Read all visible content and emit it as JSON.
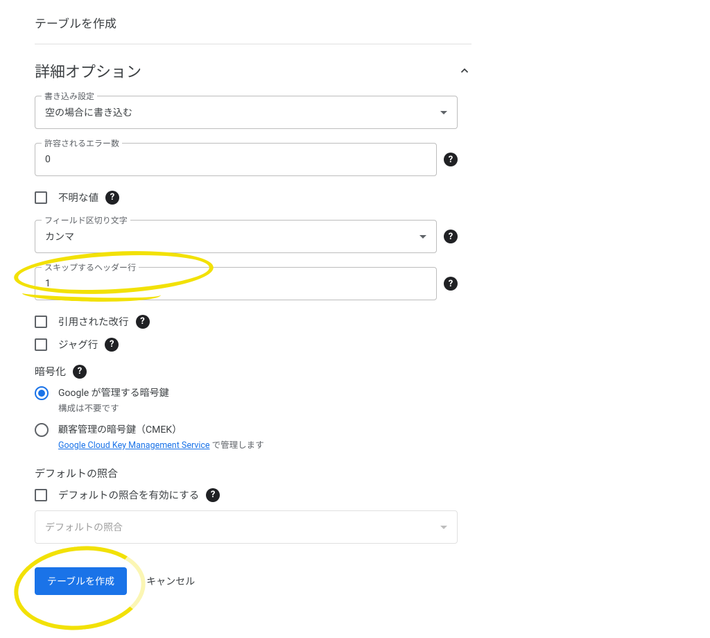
{
  "dialog": {
    "title": "テーブルを作成"
  },
  "advanced": {
    "title": "詳細オプション",
    "expanded": true,
    "write_setting": {
      "label": "書き込み設定",
      "value": "空の場合に書き込む"
    },
    "allowed_errors": {
      "label": "許容されるエラー数",
      "value": "0"
    },
    "unknown_values": {
      "label": "不明な値"
    },
    "field_delimiter": {
      "label": "フィールド区切り文字",
      "value": "カンマ"
    },
    "header_rows": {
      "label": "スキップするヘッダー行",
      "value": "1"
    },
    "quoted_newlines": {
      "label": "引用された改行"
    },
    "jagged_rows": {
      "label": "ジャグ行"
    },
    "encryption": {
      "title": "暗号化",
      "google": {
        "label": "Google が管理する暗号鍵",
        "desc": "構成は不要です"
      },
      "cmek": {
        "label": "顧客管理の暗号鍵（CMEK）",
        "link_text": "Google Cloud Key Management Service",
        "suffix": " で管理します"
      }
    },
    "collation": {
      "title": "デフォルトの照合",
      "enable_label": "デフォルトの照合を有効にする",
      "placeholder": "デフォルトの照合"
    }
  },
  "footer": {
    "create": "テーブルを作成",
    "cancel": "キャンセル"
  },
  "icons": {
    "help": "?",
    "chevron_up": "chevron-up",
    "dropdown": "dropdown"
  }
}
